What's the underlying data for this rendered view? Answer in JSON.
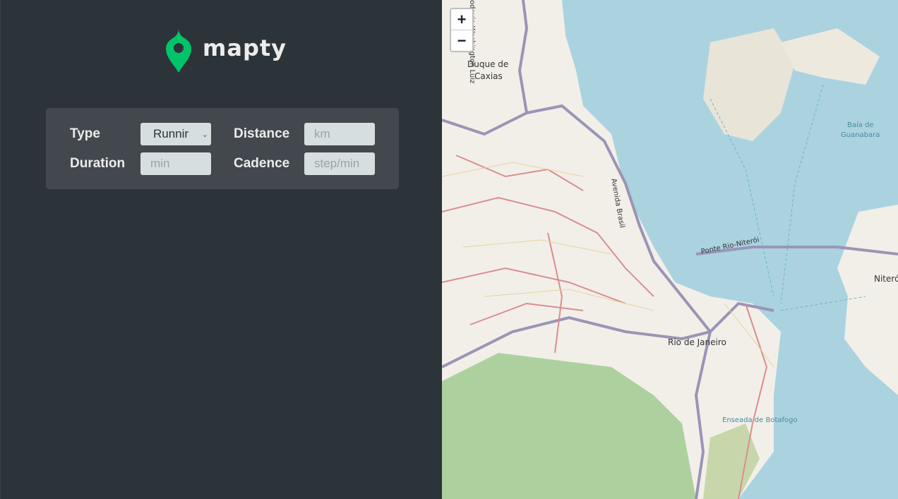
{
  "logo": {
    "text": "mapty",
    "color": "#00c46a"
  },
  "form": {
    "type_label": "Type",
    "type_value": "Runnir",
    "distance_label": "Distance",
    "distance_placeholder": "km",
    "duration_label": "Duration",
    "duration_placeholder": "min",
    "cadence_label": "Cadence",
    "cadence_placeholder": "step/min"
  },
  "map": {
    "zoom_in": "+",
    "zoom_out": "−",
    "labels": {
      "duque": "Duque de",
      "caxias": "Caxias",
      "washington": "odovia Washington Luiz",
      "avenida": "Avenida Brasil",
      "ponte": "Ponte Rio-Niterói",
      "rio": "Rio de Janeiro",
      "niteroi": "Niterói",
      "baia1": "Baía de",
      "baia2": "Guanabara",
      "enseada": "Enseada de Botafogo"
    }
  }
}
